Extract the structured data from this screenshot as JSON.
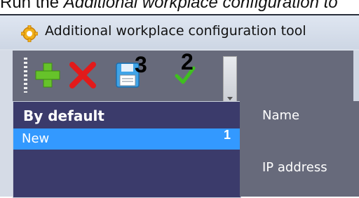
{
  "caption": {
    "prefix": "Run the ",
    "italic": "Additional workplace configuration to"
  },
  "window": {
    "title": "Additional workplace configuration tool"
  },
  "toolbar": {
    "add_label": "",
    "delete_label": "",
    "save_number": "3",
    "apply_number": "2"
  },
  "list": {
    "header": "By default",
    "items": [
      {
        "label": "New",
        "number": "1"
      }
    ]
  },
  "form": {
    "name_label": "Name",
    "ip_label": "IP address"
  },
  "colors": {
    "accent": "#3399ff",
    "list_bg": "#3b3b6b",
    "panel_bg": "#676a7b"
  },
  "icons": [
    "gear-icon",
    "add-icon",
    "delete-icon",
    "save-icon",
    "check-icon"
  ]
}
